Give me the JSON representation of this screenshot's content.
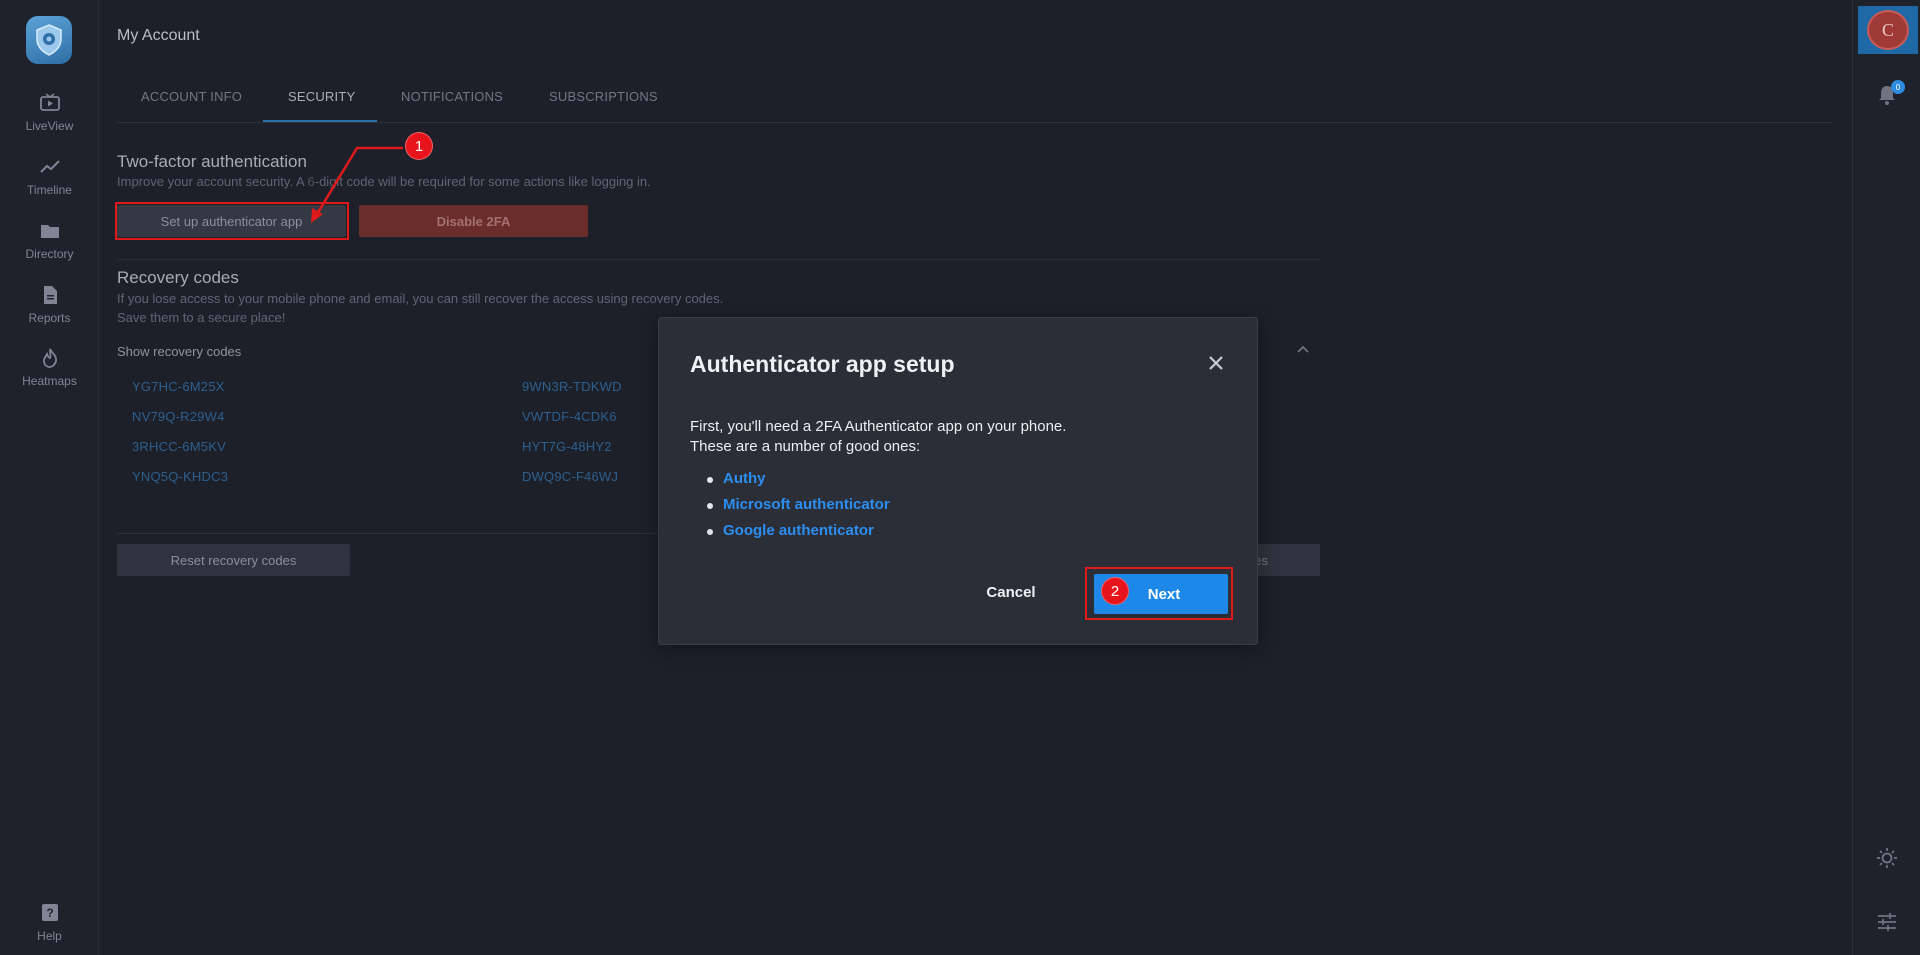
{
  "sidebar": {
    "logo": "shield-logo",
    "items": [
      {
        "label": "LiveView",
        "icon": "tv-play-icon"
      },
      {
        "label": "Timeline",
        "icon": "trend-line-icon"
      },
      {
        "label": "Directory",
        "icon": "folder-icon"
      },
      {
        "label": "Reports",
        "icon": "document-icon"
      },
      {
        "label": "Heatmaps",
        "icon": "flame-icon"
      }
    ],
    "help": {
      "label": "Help",
      "icon": "help-icon"
    }
  },
  "header": {
    "title": "My Account"
  },
  "tabs": [
    {
      "label": "ACCOUNT INFO",
      "active": false
    },
    {
      "label": "SECURITY",
      "active": true
    },
    {
      "label": "NOTIFICATIONS",
      "active": false
    },
    {
      "label": "SUBSCRIPTIONS",
      "active": false
    }
  ],
  "two_factor": {
    "title": "Two-factor authentication",
    "description_before": "Improve your account security. A ",
    "description_after": "-digit code will be required for some actions like logging in.",
    "setup_button": "Set up authenticator app",
    "disable_button": "Disable 2FA"
  },
  "recovery": {
    "title": "Recovery codes",
    "line1": "If you lose access to your mobile phone and email, you can still recover the access using recovery codes.",
    "line2": "Save them to a secure place!",
    "show_label": "Show recovery codes",
    "codes_left": [
      "YG7HC-6M25X",
      "NV79Q-R29W4",
      "3RHCC-6M5KV",
      "YNQ5Q-KHDC3"
    ],
    "codes_right": [
      "9WN3R-TDKWD",
      "VWTDF-4CDK6",
      "HYT7G-48HY2",
      "DWQ9C-F46WJ"
    ],
    "reset_button": "Reset recovery codes",
    "right_button_partial": "es"
  },
  "right_rail": {
    "avatar_initial": "C",
    "notification_count": "0"
  },
  "modal": {
    "title": "Authenticator app setup",
    "line1": "First, you'll need a 2FA Authenticator app on your phone.",
    "line2": "These are a number of good ones:",
    "apps": [
      "Authy",
      "Microsoft authenticator",
      "Google authenticator"
    ],
    "cancel_label": "Cancel",
    "next_label": "Next"
  },
  "annotations": {
    "marker1": "1",
    "marker2": "2"
  },
  "colors": {
    "background": "#1d2029",
    "accent": "#1e88e8",
    "danger": "#6b2c2c",
    "annotation": "#e01a1a"
  }
}
